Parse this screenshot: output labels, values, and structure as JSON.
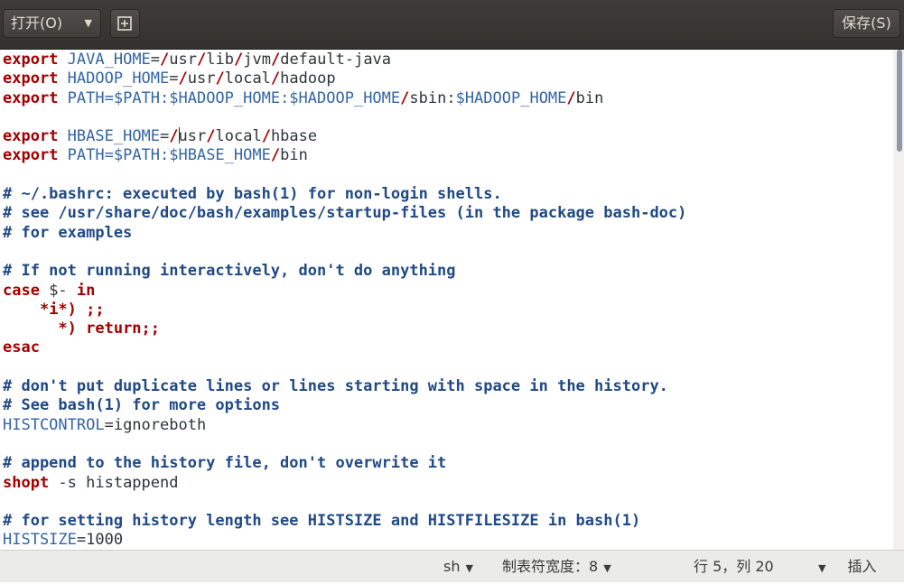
{
  "toolbar": {
    "open_label": "打开(O)",
    "save_label": "保存(S)"
  },
  "editor": {
    "lines": [
      [
        {
          "t": "export",
          "c": "kw"
        },
        {
          "t": " ",
          "c": "plain"
        },
        {
          "t": "JAVA_HOME",
          "c": "var"
        },
        {
          "t": "=",
          "c": "plain"
        },
        {
          "t": "/",
          "c": "op"
        },
        {
          "t": "usr",
          "c": "plain"
        },
        {
          "t": "/",
          "c": "op"
        },
        {
          "t": "lib",
          "c": "plain"
        },
        {
          "t": "/",
          "c": "op"
        },
        {
          "t": "jvm",
          "c": "plain"
        },
        {
          "t": "/",
          "c": "op"
        },
        {
          "t": "default-java",
          "c": "plain"
        }
      ],
      [
        {
          "t": "export",
          "c": "kw"
        },
        {
          "t": " ",
          "c": "plain"
        },
        {
          "t": "HADOOP_HOME",
          "c": "var"
        },
        {
          "t": "=",
          "c": "plain"
        },
        {
          "t": "/",
          "c": "op"
        },
        {
          "t": "usr",
          "c": "plain"
        },
        {
          "t": "/",
          "c": "op"
        },
        {
          "t": "local",
          "c": "plain"
        },
        {
          "t": "/",
          "c": "op"
        },
        {
          "t": "hadoop",
          "c": "plain"
        }
      ],
      [
        {
          "t": "export",
          "c": "kw"
        },
        {
          "t": " ",
          "c": "plain"
        },
        {
          "t": "PATH=$PATH:$HADOOP_HOME:$HADOOP_HOME",
          "c": "var"
        },
        {
          "t": "/",
          "c": "op"
        },
        {
          "t": "sbin:",
          "c": "plain"
        },
        {
          "t": "$HADOOP_HOME",
          "c": "var"
        },
        {
          "t": "/",
          "c": "op"
        },
        {
          "t": "bin",
          "c": "plain"
        }
      ],
      [],
      [
        {
          "t": "export",
          "c": "kw"
        },
        {
          "t": " ",
          "c": "plain"
        },
        {
          "t": "HBASE_HOME",
          "c": "var"
        },
        {
          "t": "=",
          "c": "plain"
        },
        {
          "t": "/",
          "c": "op"
        },
        {
          "t": "|",
          "c": "cursor"
        },
        {
          "t": "usr",
          "c": "plain"
        },
        {
          "t": "/",
          "c": "op"
        },
        {
          "t": "local",
          "c": "plain"
        },
        {
          "t": "/",
          "c": "op"
        },
        {
          "t": "hbase",
          "c": "plain"
        }
      ],
      [
        {
          "t": "export",
          "c": "kw"
        },
        {
          "t": " ",
          "c": "plain"
        },
        {
          "t": "PATH=$PATH:$HBASE_HOME",
          "c": "var"
        },
        {
          "t": "/",
          "c": "op"
        },
        {
          "t": "bin",
          "c": "plain"
        }
      ],
      [],
      [
        {
          "t": "# ~/.bashrc: executed by bash(1) for non-login shells.",
          "c": "com"
        }
      ],
      [
        {
          "t": "# see /usr/share/doc/bash/examples/startup-files (in the package bash-doc)",
          "c": "com"
        }
      ],
      [
        {
          "t": "# for examples",
          "c": "com"
        }
      ],
      [],
      [
        {
          "t": "# If not running interactively, don't do anything",
          "c": "com"
        }
      ],
      [
        {
          "t": "case",
          "c": "kw"
        },
        {
          "t": " $- ",
          "c": "plain"
        },
        {
          "t": "in",
          "c": "kw"
        }
      ],
      [
        {
          "t": "    ",
          "c": "plain"
        },
        {
          "t": "*i*) ;;",
          "c": "kw"
        }
      ],
      [
        {
          "t": "      ",
          "c": "plain"
        },
        {
          "t": "*) return;;",
          "c": "kw"
        }
      ],
      [
        {
          "t": "esac",
          "c": "kw"
        }
      ],
      [],
      [
        {
          "t": "# don't put duplicate lines or lines starting with space in the history.",
          "c": "com"
        }
      ],
      [
        {
          "t": "# See bash(1) for more options",
          "c": "com"
        }
      ],
      [
        {
          "t": "HISTCONTROL",
          "c": "var"
        },
        {
          "t": "=ignoreboth",
          "c": "plain"
        }
      ],
      [],
      [
        {
          "t": "# append to the history file, don't overwrite it",
          "c": "com"
        }
      ],
      [
        {
          "t": "shopt",
          "c": "kw"
        },
        {
          "t": " -s histappend",
          "c": "plain"
        }
      ],
      [],
      [
        {
          "t": "# for setting history length see HISTSIZE and HISTFILESIZE in bash(1)",
          "c": "com"
        }
      ],
      [
        {
          "t": "HISTSIZE",
          "c": "var"
        },
        {
          "t": "=1000",
          "c": "plain"
        }
      ]
    ]
  },
  "statusbar": {
    "language": "sh",
    "tab_width": "制表符宽度：8",
    "position": "行 5，列 20",
    "insert_mode": "插入"
  }
}
